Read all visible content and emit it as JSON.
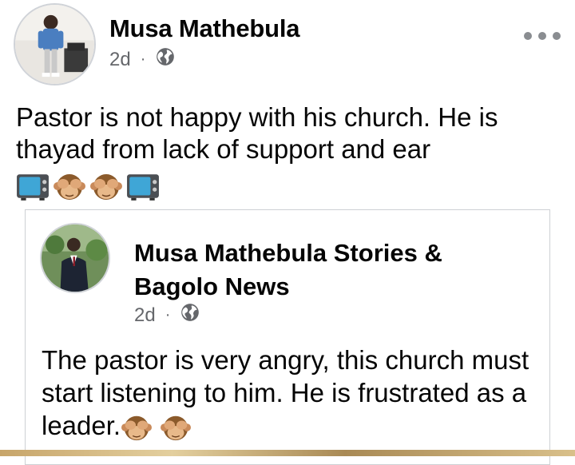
{
  "post": {
    "author_name": "Musa Mathebula",
    "time": "2d",
    "separator": "·",
    "privacy_icon": "globe-icon",
    "more_icon": "more-options-icon",
    "text": "Pastor is not happy with his church. He is thayad from lack of support and ear",
    "emojis": [
      "television-emoji",
      "see-no-evil-monkey-emoji",
      "see-no-evil-monkey-emoji",
      "television-emoji"
    ]
  },
  "shared_post": {
    "page_name": "Musa Mathebula Stories & Bagolo News",
    "time": "2d",
    "separator": "·",
    "privacy_icon": "globe-icon",
    "text": "The pastor is very angry, this church must start listening to him. He is frustrated as a leader.",
    "emojis": [
      "see-no-evil-monkey-emoji",
      "see-no-evil-monkey-emoji"
    ]
  },
  "colors": {
    "text_primary": "#050505",
    "text_secondary": "#65676b",
    "card_border": "#ced0d4"
  }
}
